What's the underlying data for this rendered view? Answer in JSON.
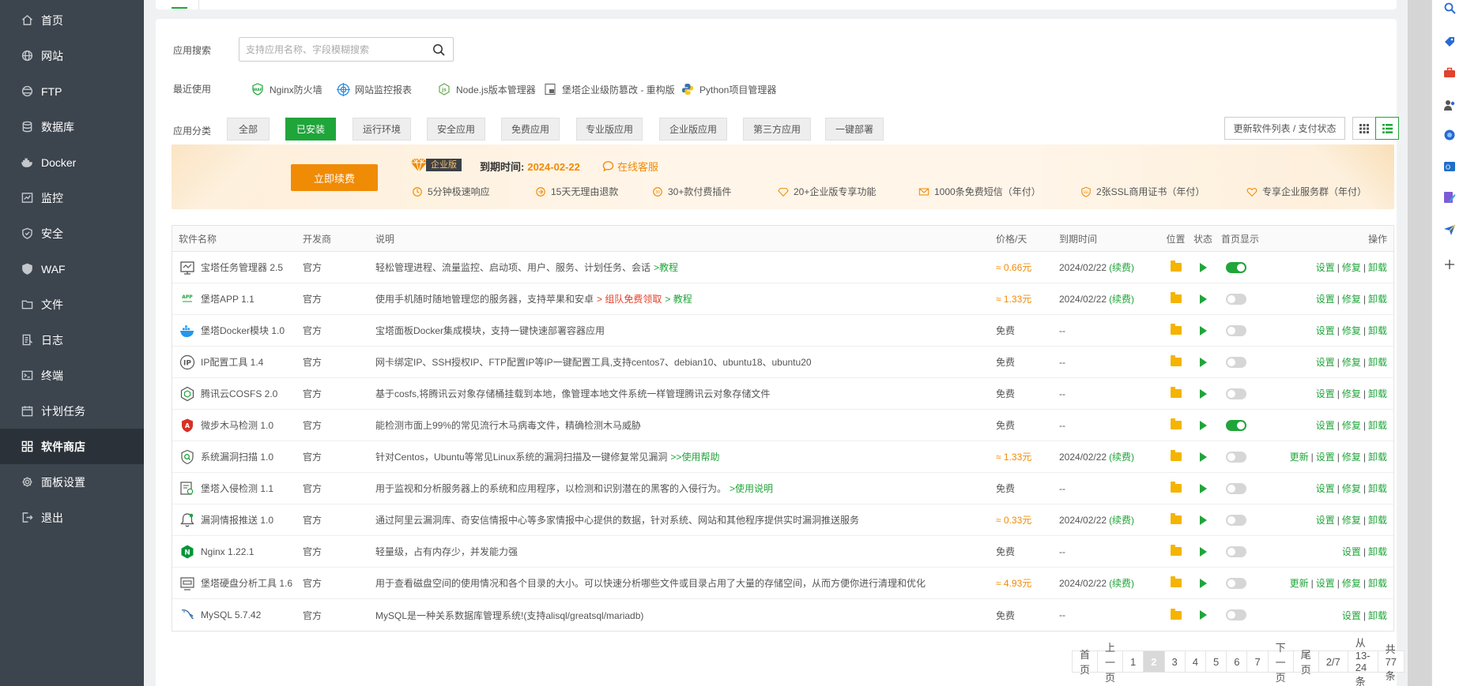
{
  "sidebar": {
    "items": [
      {
        "label": "首页",
        "icon": "home-icon"
      },
      {
        "label": "网站",
        "icon": "globe-icon"
      },
      {
        "label": "FTP",
        "icon": "ftp-icon"
      },
      {
        "label": "数据库",
        "icon": "database-icon"
      },
      {
        "label": "Docker",
        "icon": "docker-icon"
      },
      {
        "label": "监控",
        "icon": "monitor-icon"
      },
      {
        "label": "安全",
        "icon": "shield-icon"
      },
      {
        "label": "WAF",
        "icon": "waf-shield-icon"
      },
      {
        "label": "文件",
        "icon": "folder-icon"
      },
      {
        "label": "日志",
        "icon": "log-icon"
      },
      {
        "label": "终端",
        "icon": "terminal-icon"
      },
      {
        "label": "计划任务",
        "icon": "calendar-icon"
      },
      {
        "label": "软件商店",
        "icon": "grid-icon"
      },
      {
        "label": "面板设置",
        "icon": "gear-icon"
      },
      {
        "label": "退出",
        "icon": "logout-icon"
      }
    ],
    "active_index": 12
  },
  "search": {
    "label": "应用搜索",
    "placeholder": "支持应用名称、字段模糊搜索"
  },
  "recent": {
    "label": "最近使用",
    "items": [
      "Nginx防火墙",
      "网站监控报表",
      "Node.js版本管理器",
      "堡塔企业级防篡改 - 重构版",
      "Python项目管理器"
    ]
  },
  "categories": {
    "label": "应用分类",
    "items": [
      "全部",
      "已安装",
      "运行环境",
      "安全应用",
      "免费应用",
      "专业版应用",
      "企业版应用",
      "第三方应用",
      "一键部署"
    ],
    "active_index": 1
  },
  "toolbar": {
    "update_label": "更新软件列表 / 支付状态"
  },
  "banner": {
    "renew_label": "立即续费",
    "badge": "企业版",
    "expire_label": "到期时间:",
    "expire_date": "2024-02-22",
    "service_label": "在线客服",
    "perks": [
      "5分钟极速响应",
      "15天无理由退款",
      "30+款付费插件",
      "20+企业版专享功能",
      "1000条免费短信（年付）",
      "2张SSL商用证书（年付）",
      "专享企业服务群（年付）"
    ]
  },
  "table": {
    "headers": {
      "name": "软件名称",
      "dev": "开发商",
      "desc": "说明",
      "price": "价格/天",
      "expire": "到期时间",
      "loc": "位置",
      "status": "状态",
      "home": "首页显示",
      "ops": "操作"
    },
    "rows": [
      {
        "name": "宝塔任务管理器 2.5",
        "dev": "官方",
        "desc": "轻松管理进程、流量监控、启动项、用户、服务、计划任务、会话",
        "desc_link": ">教程",
        "desc_link2": "",
        "price": "≈ 0.66元",
        "expire": "2024/02/22",
        "renew": "(续费)",
        "home_on": true,
        "ops": [
          "设置",
          "修复",
          "卸载"
        ]
      },
      {
        "name": "堡塔APP 1.1",
        "dev": "官方",
        "desc": "使用手机随时随地管理您的服务器，支持苹果和安卓",
        "desc_red": "> 组队免费领取",
        "desc_link": "> 教程",
        "price": "≈ 1.33元",
        "expire": "2024/02/22",
        "renew": "(续费)",
        "home_on": false,
        "ops": [
          "设置",
          "修复",
          "卸载"
        ]
      },
      {
        "name": "堡塔Docker模块 1.0",
        "dev": "官方",
        "desc": "宝塔面板Docker集成模块，支持一键快速部署容器应用",
        "price": "免费",
        "expire": "--",
        "renew": "",
        "home_on": false,
        "ops": [
          "设置",
          "修复",
          "卸载"
        ]
      },
      {
        "name": "IP配置工具 1.4",
        "dev": "官方",
        "desc": "网卡绑定IP、SSH授权IP、FTP配置IP等IP一键配置工具,支持centos7、debian10、ubuntu18、ubuntu20",
        "price": "免费",
        "expire": "--",
        "renew": "",
        "home_on": false,
        "ops": [
          "设置",
          "修复",
          "卸载"
        ]
      },
      {
        "name": "腾讯云COSFS 2.0",
        "dev": "官方",
        "desc": "基于cosfs,将腾讯云对象存储桶挂载到本地，像管理本地文件系统一样管理腾讯云对象存储文件",
        "price": "免费",
        "expire": "--",
        "renew": "",
        "home_on": false,
        "ops": [
          "设置",
          "修复",
          "卸载"
        ]
      },
      {
        "name": "微步木马检测 1.0",
        "dev": "官方",
        "desc": "能检测市面上99%的常见流行木马病毒文件，精确检测木马威胁",
        "price": "免费",
        "expire": "--",
        "renew": "",
        "home_on": true,
        "ops": [
          "设置",
          "修复",
          "卸载"
        ]
      },
      {
        "name": "系统漏洞扫描 1.0",
        "dev": "官方",
        "desc": "针对Centos，Ubuntu等常见Linux系统的漏洞扫描及一键修复常见漏洞",
        "desc_link": ">>使用帮助",
        "price": "≈ 1.33元",
        "expire": "2024/02/22",
        "renew": "(续费)",
        "home_on": false,
        "ops": [
          "更新",
          "设置",
          "修复",
          "卸载"
        ]
      },
      {
        "name": "堡塔入侵检测 1.1",
        "dev": "官方",
        "desc": "用于监视和分析服务器上的系统和应用程序，以检测和识别潜在的黑客的入侵行为。",
        "desc_link": ">使用说明",
        "price": "免费",
        "expire": "--",
        "renew": "",
        "home_on": false,
        "ops": [
          "设置",
          "修复",
          "卸载"
        ]
      },
      {
        "name": "漏洞情报推送 1.0",
        "dev": "官方",
        "desc": "通过阿里云漏洞库、奇安信情报中心等多家情报中心提供的数据，针对系统、网站和其他程序提供实时漏洞推送服务",
        "price": "≈ 0.33元",
        "expire": "2024/02/22",
        "renew": "(续费)",
        "home_on": false,
        "ops": [
          "设置",
          "修复",
          "卸载"
        ]
      },
      {
        "name": "Nginx 1.22.1",
        "dev": "官方",
        "desc": "轻量级，占有内存少，并发能力强",
        "price": "免费",
        "expire": "--",
        "renew": "",
        "home_on": false,
        "ops": [
          "设置",
          "卸载"
        ]
      },
      {
        "name": "堡塔硬盘分析工具 1.6",
        "dev": "官方",
        "desc": "用于查看磁盘空间的使用情况和各个目录的大小。可以快速分析哪些文件或目录占用了大量的存储空间，从而方便你进行清理和优化",
        "price": "≈ 4.93元",
        "expire": "2024/02/22",
        "renew": "(续费)",
        "home_on": false,
        "ops": [
          "更新",
          "设置",
          "修复",
          "卸载"
        ]
      },
      {
        "name": "MySQL 5.7.42",
        "dev": "官方",
        "desc": "MySQL是一种关系数据库管理系统!(支持alisql/greatsql/mariadb)",
        "price": "免费",
        "expire": "--",
        "renew": "",
        "home_on": false,
        "ops": [
          "设置",
          "卸载"
        ]
      }
    ]
  },
  "pager": {
    "first": "首页",
    "prev": "上一页",
    "pages": [
      "1",
      "2",
      "3",
      "4",
      "5",
      "6",
      "7"
    ],
    "current": "2",
    "next": "下一页",
    "last": "尾页",
    "page_of": "2/7",
    "range": "从13-24条",
    "total": "共77条"
  },
  "colors": {
    "accent": "#20a53a",
    "orange": "#f08b06",
    "sidebar": "#3c444d"
  }
}
